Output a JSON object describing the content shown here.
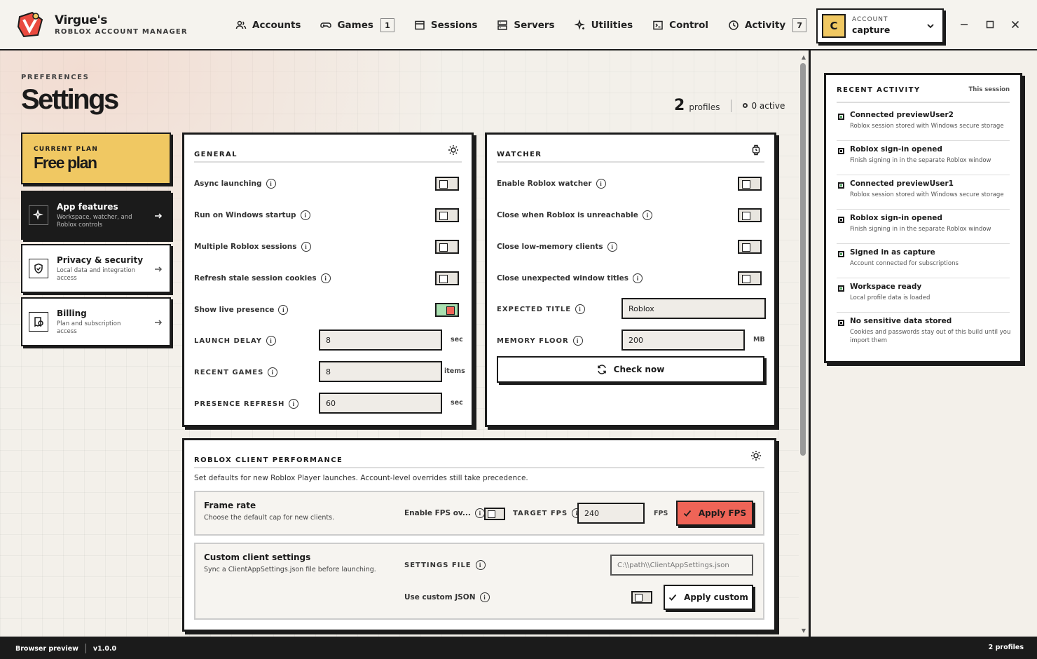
{
  "app": {
    "name": "Virgue's",
    "subtitle": "ROBLOX ACCOUNT MANAGER"
  },
  "nav": [
    {
      "label": "Accounts",
      "icon": "users-icon"
    },
    {
      "label": "Games",
      "icon": "gamepad-icon",
      "badge": "1"
    },
    {
      "label": "Sessions",
      "icon": "window-icon"
    },
    {
      "label": "Servers",
      "icon": "server-icon"
    },
    {
      "label": "Utilities",
      "icon": "sparkle-icon"
    },
    {
      "label": "Control",
      "icon": "terminal-icon"
    },
    {
      "label": "Activity",
      "icon": "clock-icon",
      "badge": "7"
    }
  ],
  "account": {
    "label": "ACCOUNT",
    "name": "capture",
    "initial": "C"
  },
  "header": {
    "breadcrumb": "PREFERENCES",
    "title": "Settings",
    "profiles_count": "2",
    "profiles_label": "profiles",
    "active_label": "0 active"
  },
  "plan": {
    "label": "CURRENT PLAN",
    "name": "Free plan"
  },
  "sidebar": [
    {
      "title": "App features",
      "desc": "Workspace, watcher, and Roblox controls",
      "active": true
    },
    {
      "title": "Privacy & security",
      "desc": "Local data and integration access"
    },
    {
      "title": "Billing",
      "desc": "Plan and subscription access"
    }
  ],
  "general": {
    "title": "GENERAL",
    "toggles": [
      {
        "label": "Async launching",
        "on": false
      },
      {
        "label": "Run on Windows startup",
        "on": false
      },
      {
        "label": "Multiple Roblox sessions",
        "on": false
      },
      {
        "label": "Refresh stale session cookies",
        "on": false
      },
      {
        "label": "Show live presence",
        "on": true
      }
    ],
    "fields": [
      {
        "label": "LAUNCH DELAY",
        "value": "8",
        "unit": "sec"
      },
      {
        "label": "RECENT GAMES",
        "value": "8",
        "unit": "items"
      },
      {
        "label": "PRESENCE REFRESH",
        "value": "60",
        "unit": "sec"
      }
    ]
  },
  "watcher": {
    "title": "WATCHER",
    "toggles": [
      {
        "label": "Enable Roblox watcher",
        "on": false
      },
      {
        "label": "Close when Roblox is unreachable",
        "on": false
      },
      {
        "label": "Close low-memory clients",
        "on": false
      },
      {
        "label": "Close unexpected window titles",
        "on": false
      }
    ],
    "expected_title": {
      "label": "EXPECTED TITLE",
      "value": "Roblox"
    },
    "memory_floor": {
      "label": "MEMORY FLOOR",
      "value": "200",
      "unit": "MB"
    },
    "check_now": "Check now"
  },
  "performance": {
    "title": "ROBLOX CLIENT PERFORMANCE",
    "description": "Set defaults for new Roblox Player launches. Account-level overrides still take precedence.",
    "frame_rate": {
      "title": "Frame rate",
      "desc": "Choose the default cap for new clients.",
      "enable_label": "Enable FPS ov...",
      "target_label": "TARGET FPS",
      "target_value": "240",
      "unit": "FPS",
      "apply": "Apply FPS"
    },
    "custom": {
      "title": "Custom client settings",
      "desc": "Sync a ClientAppSettings.json file before launching.",
      "file_label": "SETTINGS FILE",
      "file_placeholder": "C:\\\\path\\\\ClientAppSettings.json",
      "json_label": "Use custom JSON",
      "apply": "Apply custom"
    }
  },
  "activity": {
    "title": "RECENT ACTIVITY",
    "subtitle": "This session",
    "items": [
      {
        "name": "Connected previewUser2",
        "desc": "Roblox session stored with Windows secure storage",
        "kind": "green"
      },
      {
        "name": "Roblox sign-in opened",
        "desc": "Finish signing in in the separate Roblox window",
        "kind": "dark"
      },
      {
        "name": "Connected previewUser1",
        "desc": "Roblox session stored with Windows secure storage",
        "kind": "green"
      },
      {
        "name": "Roblox sign-in opened",
        "desc": "Finish signing in in the separate Roblox window",
        "kind": "dark"
      },
      {
        "name": "Signed in as capture",
        "desc": "Account connected for subscriptions",
        "kind": "green"
      },
      {
        "name": "Workspace ready",
        "desc": "Local profile data is loaded",
        "kind": "green"
      },
      {
        "name": "No sensitive data stored",
        "desc": "Cookies and passwords stay out of this build until you import them",
        "kind": "dark"
      }
    ]
  },
  "footer": {
    "mode": "Browser preview",
    "version": "v1.0.0",
    "profiles": "2 profiles"
  },
  "colors": {
    "accent_red": "#ef6457",
    "plan_yellow": "#f0c862",
    "ink": "#1b1b1b"
  }
}
